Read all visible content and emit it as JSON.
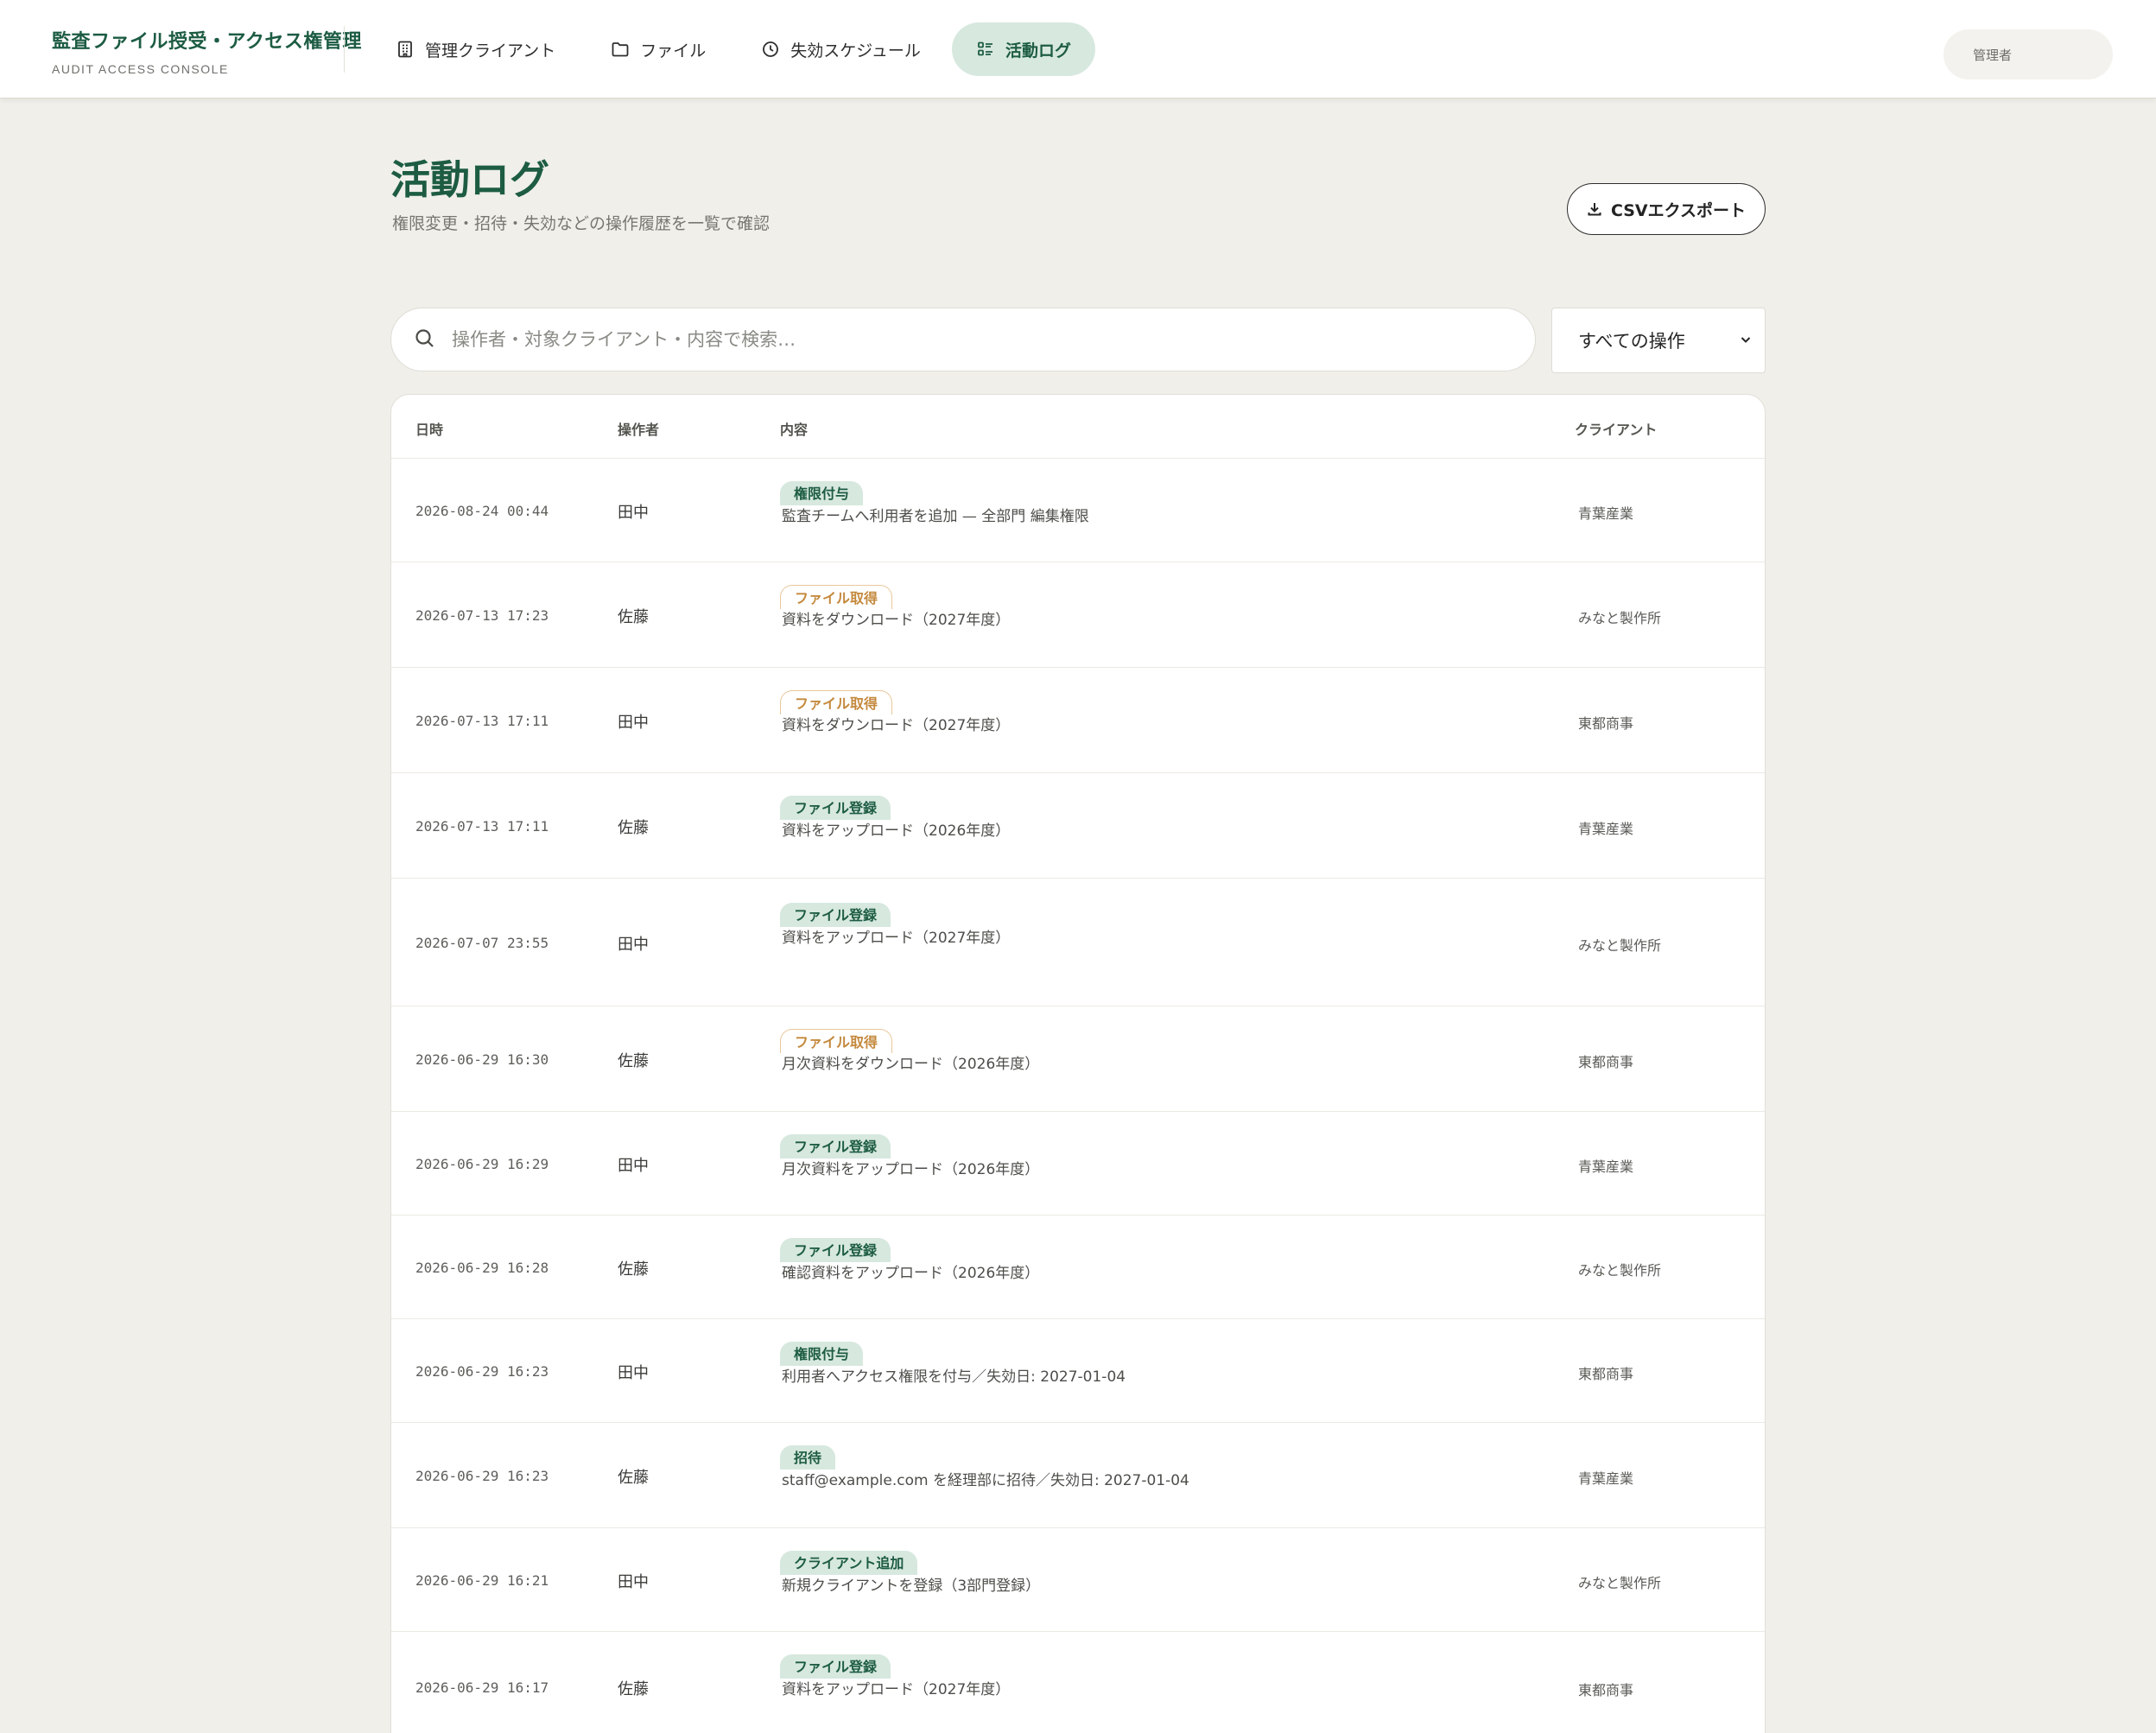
{
  "brand": {
    "title": "監査ファイル授受・アクセス権管理",
    "subtitle": "AUDIT ACCESS CONSOLE"
  },
  "nav": [
    {
      "label": "管理クライアント",
      "icon": "building-icon",
      "active": false
    },
    {
      "label": "ファイル",
      "icon": "folder-icon",
      "active": false
    },
    {
      "label": "失効スケジュール",
      "icon": "clock-icon",
      "active": false
    },
    {
      "label": "活動ログ",
      "icon": "list-icon",
      "active": true
    }
  ],
  "user": {
    "label": "管理者"
  },
  "page": {
    "title": "活動ログ",
    "subtitle": "権限変更・招待・失効などの操作履歴を一覧で確認"
  },
  "toolbar": {
    "export_label": "CSVエクスポート"
  },
  "search": {
    "placeholder": "操作者・対象クライアント・内容で検索…",
    "value": ""
  },
  "filter": {
    "selected": "すべての操作"
  },
  "table": {
    "headers": {
      "date": "日時",
      "operator": "操作者",
      "content": "内容",
      "client": "クライアント"
    },
    "rows": [
      {
        "date": "2026-08-24 00:44",
        "operator": "田中",
        "type": "権限付与",
        "tone": "green",
        "desc": "監査チームへ利用者を追加 — 全部門 編集権限",
        "client": "青葉産業"
      },
      {
        "date": "2026-07-13 17:23",
        "operator": "佐藤",
        "type": "ファイル取得",
        "tone": "orange",
        "desc": "資料をダウンロード（2027年度）",
        "client": "みなと製作所"
      },
      {
        "date": "2026-07-13 17:11",
        "operator": "田中",
        "type": "ファイル取得",
        "tone": "orange",
        "desc": "資料をダウンロード（2027年度）",
        "client": "東都商事"
      },
      {
        "date": "2026-07-13 17:11",
        "operator": "佐藤",
        "type": "ファイル登録",
        "tone": "green",
        "desc": "資料をアップロード（2026年度）",
        "client": "青葉産業"
      },
      {
        "date": "2026-07-07 23:55",
        "operator": "田中",
        "type": "ファイル登録",
        "tone": "green",
        "desc": "資料をアップロード（2027年度）",
        "client": "みなと製作所"
      },
      {
        "date": "2026-06-29 16:30",
        "operator": "佐藤",
        "type": "ファイル取得",
        "tone": "orange",
        "desc": "月次資料をダウンロード（2026年度）",
        "client": "東都商事"
      },
      {
        "date": "2026-06-29 16:29",
        "operator": "田中",
        "type": "ファイル登録",
        "tone": "green",
        "desc": "月次資料をアップロード（2026年度）",
        "client": "青葉産業"
      },
      {
        "date": "2026-06-29 16:28",
        "operator": "佐藤",
        "type": "ファイル登録",
        "tone": "green",
        "desc": "確認資料をアップロード（2026年度）",
        "client": "みなと製作所"
      },
      {
        "date": "2026-06-29 16:23",
        "operator": "田中",
        "type": "権限付与",
        "tone": "green",
        "desc": "利用者へアクセス権限を付与／失効日: 2027-01-04",
        "client": "東都商事"
      },
      {
        "date": "2026-06-29 16:23",
        "operator": "佐藤",
        "type": "招待",
        "tone": "green",
        "desc": "staff@example.com を経理部に招待／失効日: 2027-01-04",
        "client": "青葉産業"
      },
      {
        "date": "2026-06-29 16:21",
        "operator": "田中",
        "type": "クライアント追加",
        "tone": "green",
        "desc": "新規クライアントを登録（3部門登録）",
        "client": "みなと製作所"
      },
      {
        "date": "2026-06-29 16:17",
        "operator": "佐藤",
        "type": "ファイル登録",
        "tone": "green",
        "desc": "資料をアップロード（2027年度）",
        "client": "東都商事"
      }
    ]
  }
}
